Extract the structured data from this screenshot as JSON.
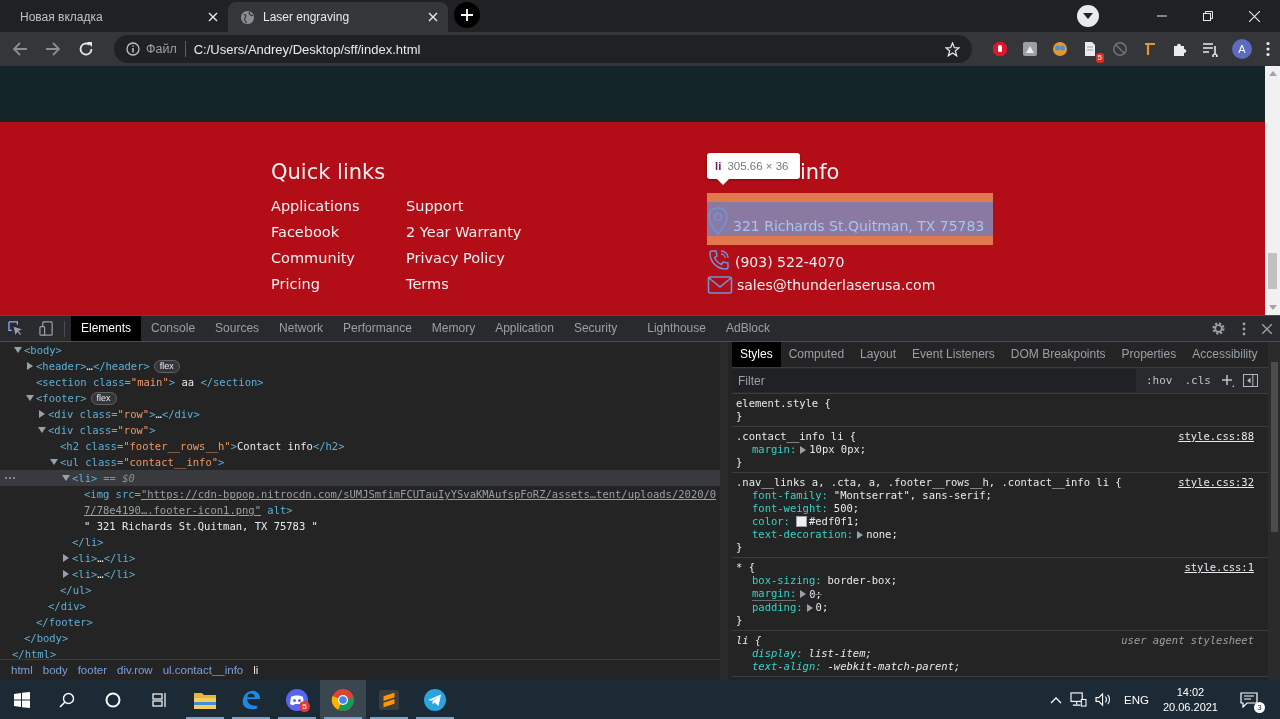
{
  "browser": {
    "tabs": [
      {
        "title": "Новая вкладка",
        "selected": false
      },
      {
        "title": "Laser engraving",
        "selected": true
      }
    ],
    "address": {
      "scheme": "Файл",
      "url": "C:/Users/Andrey/Desktop/sff/index.html"
    },
    "extension_badge": "5",
    "profile_initial": "A"
  },
  "page": {
    "quick_links": {
      "title": "Quick links",
      "columns": [
        [
          "Applications",
          "Facebook",
          "Community",
          "Pricing"
        ],
        [
          "Support",
          "2 Year Warranty",
          "Privacy Policy",
          "Terms"
        ]
      ]
    },
    "contact": {
      "title": "info",
      "tooltip": {
        "tag": "li",
        "size": "305.66 × 36"
      },
      "items": [
        {
          "kind": "address",
          "text": "321 Richards St.Quitman, TX 75783",
          "highlighted": true
        },
        {
          "kind": "phone",
          "text": "(903) 522-4070",
          "highlighted": false
        },
        {
          "kind": "email",
          "text": "sales@thunderlaserusa.com",
          "highlighted": false
        }
      ]
    }
  },
  "devtools": {
    "tabs": [
      {
        "label": "Elements",
        "selected": true
      },
      {
        "label": "Console",
        "selected": false
      },
      {
        "label": "Sources",
        "selected": false
      },
      {
        "label": "Network",
        "selected": false
      },
      {
        "label": "Performance",
        "selected": false
      },
      {
        "label": "Memory",
        "selected": false
      },
      {
        "label": "Application",
        "selected": false
      },
      {
        "label": "Security",
        "selected": false
      },
      {
        "label": "Lighthouse",
        "selected": false
      },
      {
        "label": "AdBlock",
        "selected": false
      }
    ],
    "dom": [
      {
        "open": "<body>",
        "close": "</body>",
        "expanded": true,
        "selected": false,
        "children": [
          {
            "open": "<header>",
            "text": "…",
            "close": "</header>",
            "expanded": false,
            "badge": "flex",
            "selected": false
          },
          {
            "open": "<section class=\"main\">",
            "text": " aa ",
            "close": "</section>",
            "selected": false
          },
          {
            "open": "<footer>",
            "close": "</footer>",
            "expanded": true,
            "badge": "flex",
            "selected": false,
            "children": [
              {
                "open": "<div class=\"row\">",
                "text": "…",
                "close": "</div>",
                "expanded": false,
                "selected": false
              },
              {
                "open": "<div class=\"row\">",
                "close": "</div>",
                "expanded": true,
                "selected": false,
                "children": [
                  {
                    "open": "<h2 class=\"footer__rows__h\">",
                    "text": "Contact info",
                    "close": "</h2>",
                    "selected": false
                  },
                  {
                    "open": "<ul class=\"contact__info\">",
                    "close": "</ul>",
                    "expanded": true,
                    "selected": false,
                    "children": [
                      {
                        "open": "<li>",
                        "close": "</li>",
                        "expanded": true,
                        "selected": true,
                        "suffix": "== $0",
                        "children": [
                          {
                            "open": "<img src=\"https://cdn-bppop.nitrocdn.com/sUMJSmfimFCUTauIyYSvaKMAufspFoRZ/assets…tent/uploads/2020/07/78e4190….footer-icon1.png\" alt>",
                            "link": true,
                            "selected": false
                          },
                          {
                            "kind": "text",
                            "text": "\" 321 Richards St.Quitman, TX 75783 \""
                          }
                        ]
                      },
                      {
                        "open": "<li>",
                        "text": "…",
                        "close": "</li>",
                        "expanded": false,
                        "selected": false
                      },
                      {
                        "open": "<li>",
                        "text": "…",
                        "close": "</li>",
                        "expanded": false,
                        "selected": false
                      }
                    ]
                  }
                ]
              }
            ]
          }
        ]
      }
    ],
    "dom_tail": "</html>",
    "breadcrumbs": [
      {
        "label": "html",
        "selected": false
      },
      {
        "label": "body",
        "selected": false
      },
      {
        "label": "footer",
        "selected": false
      },
      {
        "label": "div.row",
        "selected": false
      },
      {
        "label": "ul.contact__info",
        "selected": false
      },
      {
        "label": "li",
        "selected": true
      }
    ],
    "styles": {
      "tabs": [
        {
          "label": "Styles",
          "selected": true
        },
        {
          "label": "Computed",
          "selected": false
        },
        {
          "label": "Layout",
          "selected": false
        },
        {
          "label": "Event Listeners",
          "selected": false
        },
        {
          "label": "DOM Breakpoints",
          "selected": false
        },
        {
          "label": "Properties",
          "selected": false
        },
        {
          "label": "Accessibility",
          "selected": false
        }
      ],
      "filter": {
        "placeholder": "Filter"
      },
      "hov": ":hov",
      "cls": ".cls",
      "rules": [
        {
          "selector": "element.style {",
          "close": "}",
          "user_agent": false
        },
        {
          "selector": ".contact__info li {",
          "close": "}",
          "source": "style.css:88",
          "user_agent": false,
          "props": [
            {
              "name": "margin:",
              "value": "10px 0px;",
              "expandable": true,
              "struck": false
            }
          ]
        },
        {
          "selector": ".nav__links a, .cta, a, .footer__rows__h, .contact__info li {",
          "close": "}",
          "source": "style.css:32",
          "user_agent": false,
          "props": [
            {
              "name": "font-family:",
              "value": "\"Montserrat\", sans-serif;",
              "expandable": false,
              "struck": false
            },
            {
              "name": "font-weight:",
              "value": "500;",
              "expandable": false,
              "struck": false
            },
            {
              "name": "color:",
              "value": "#edf0f1;",
              "swatch": true,
              "expandable": false,
              "struck": false
            },
            {
              "name": "text-decoration:",
              "value": "none;",
              "expandable": true,
              "struck": false
            }
          ]
        },
        {
          "selector": "* {",
          "close": "}",
          "source": "style.css:1",
          "user_agent": false,
          "props": [
            {
              "name": "box-sizing:",
              "value": "border-box;",
              "expandable": false,
              "struck": false
            },
            {
              "name": "margin:",
              "value": "0;",
              "expandable": true,
              "struck": true
            },
            {
              "name": "padding:",
              "value": "0;",
              "expandable": true,
              "struck": false
            }
          ]
        },
        {
          "selector": "li {",
          "source": "user agent stylesheet",
          "user_agent": true,
          "props": [
            {
              "name": "display:",
              "value": "list-item;",
              "expandable": false,
              "struck": false
            },
            {
              "name": "text-align:",
              "value": "-webkit-match-parent;",
              "expandable": false,
              "struck": false
            }
          ]
        }
      ]
    }
  },
  "taskbar": {
    "apps": [
      {
        "kind": "folder",
        "selected": false
      },
      {
        "kind": "edge",
        "selected": false
      },
      {
        "kind": "chat",
        "badge": "5",
        "selected": false
      },
      {
        "kind": "browser",
        "selected": true
      },
      {
        "kind": "editor",
        "selected": false
      },
      {
        "kind": "messenger",
        "selected": false
      }
    ],
    "language": "ENG",
    "time": "14:02",
    "date": "20.06.2021",
    "notifications": "3"
  }
}
